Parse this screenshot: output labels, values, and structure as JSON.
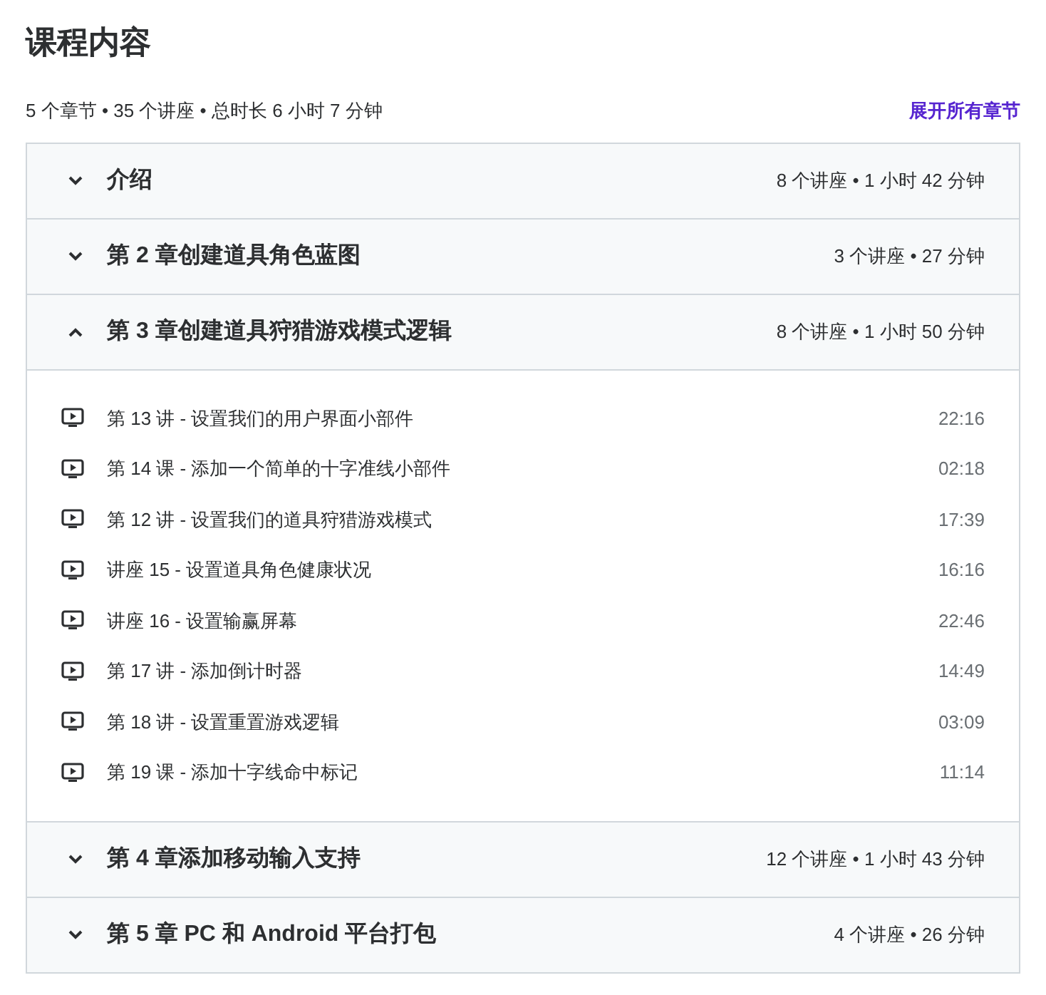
{
  "heading": "课程内容",
  "summary": "5 个章节 • 35 个讲座 • 总时长 6 小时 7 分钟",
  "expand_all": "展开所有章节",
  "sections": [
    {
      "title": "介绍",
      "meta": "8 个讲座 • 1 小时 42 分钟",
      "expanded": false
    },
    {
      "title": "第 2 章创建道具角色蓝图",
      "meta": "3 个讲座 • 27 分钟",
      "expanded": false
    },
    {
      "title": "第 3 章创建道具狩猎游戏模式逻辑",
      "meta": "8 个讲座 • 1 小时 50 分钟",
      "expanded": true,
      "lectures": [
        {
          "title": "第 13 讲 - 设置我们的用户界面小部件",
          "duration": "22:16"
        },
        {
          "title": "第 14 课 - 添加一个简单的十字准线小部件",
          "duration": "02:18"
        },
        {
          "title": "第 12 讲 - 设置我们的道具狩猎游戏模式",
          "duration": "17:39"
        },
        {
          "title": "讲座 15 - 设置道具角色健康状况",
          "duration": "16:16"
        },
        {
          "title": "讲座 16 - 设置输赢屏幕",
          "duration": "22:46"
        },
        {
          "title": "第 17 讲 - 添加倒计时器",
          "duration": "14:49"
        },
        {
          "title": "第 18 讲 - 设置重置游戏逻辑",
          "duration": "03:09"
        },
        {
          "title": "第 19 课 - 添加十字线命中标记",
          "duration": "11:14"
        }
      ]
    },
    {
      "title": "第 4 章添加移动输入支持",
      "meta": "12 个讲座 • 1 小时 43 分钟",
      "expanded": false
    },
    {
      "title": "第 5 章 PC 和 Android 平台打包",
      "meta": "4 个讲座 • 26 分钟",
      "expanded": false
    }
  ]
}
